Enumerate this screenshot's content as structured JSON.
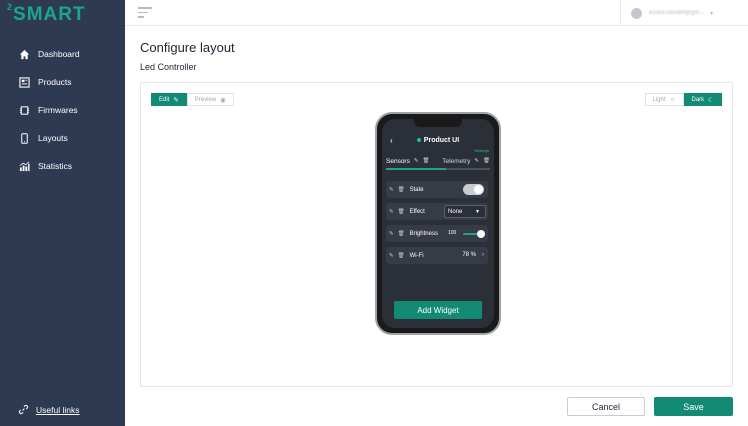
{
  "brand": {
    "logo_sup": "2",
    "logo_text": "SMART",
    "accent_color": "#138b74"
  },
  "sidebar": {
    "items": [
      {
        "label": "Dashboard",
        "icon": "home-icon"
      },
      {
        "label": "Products",
        "icon": "products-icon"
      },
      {
        "label": "Firmwares",
        "icon": "firmware-icon"
      },
      {
        "label": "Layouts",
        "icon": "phone-icon"
      },
      {
        "label": "Statistics",
        "icon": "statistics-icon"
      }
    ],
    "useful_links": "Useful links"
  },
  "topbar": {
    "user_email": "kostia.osmart@gm..."
  },
  "page": {
    "title": "Configure layout",
    "subtitle": "Led Controller"
  },
  "modes": {
    "edit": "Edit",
    "preview": "Preview",
    "light": "Light",
    "dark": "Dark"
  },
  "phone": {
    "title": "Product UI",
    "settings": "Settings",
    "tabs": [
      {
        "label": "Sensors"
      },
      {
        "label": "Telemetry"
      }
    ],
    "widgets": {
      "state": {
        "label": "State"
      },
      "effect": {
        "label": "Effect",
        "value": "None"
      },
      "brightness": {
        "label": "Brightness",
        "value": "100"
      },
      "wifi": {
        "label": "Wi-Fi",
        "value": "78 %"
      }
    },
    "add_widget": "Add Widget"
  },
  "footer": {
    "cancel": "Cancel",
    "save": "Save"
  }
}
